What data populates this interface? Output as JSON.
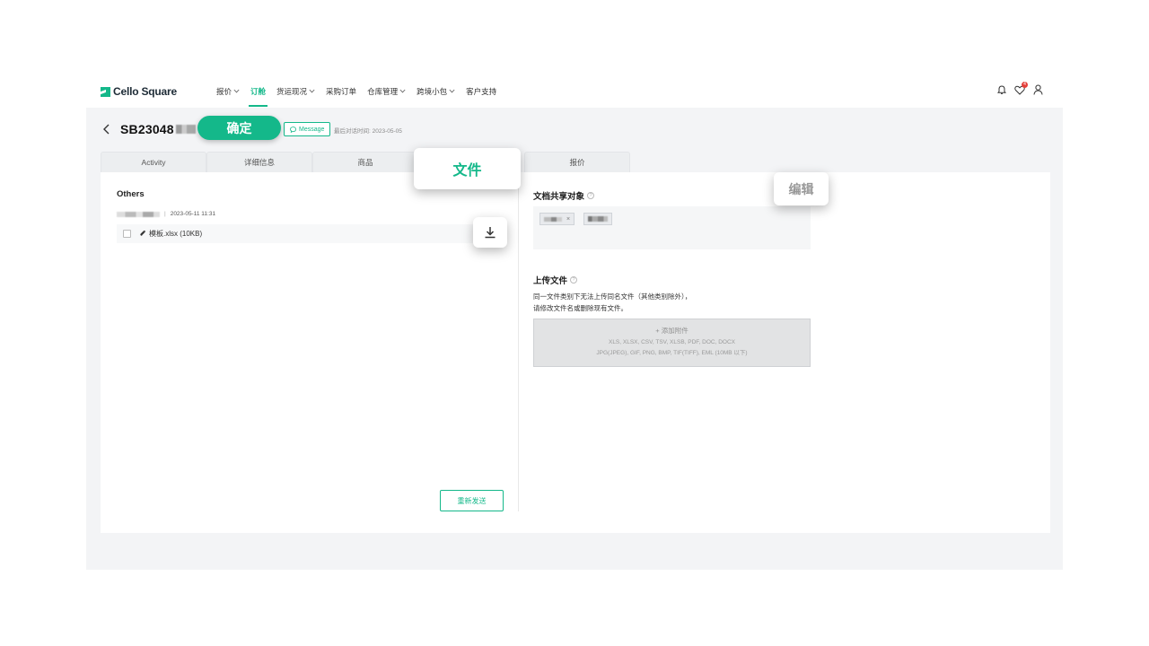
{
  "app": {
    "logo_text": "Cello Square"
  },
  "nav": {
    "items": [
      {
        "label": "报价",
        "dropdown": true
      },
      {
        "label": "订舱",
        "dropdown": false,
        "active": true
      },
      {
        "label": "货运现况",
        "dropdown": true
      },
      {
        "label": "采购订单",
        "dropdown": false
      },
      {
        "label": "仓库管理",
        "dropdown": true
      },
      {
        "label": "跨境小包",
        "dropdown": true
      },
      {
        "label": "客户支持",
        "dropdown": false
      }
    ],
    "notification_badge": "4"
  },
  "header": {
    "order_id": "SB23048",
    "message_label": "Message",
    "last_chat": "最后对话时间: 2023-05-05"
  },
  "tabs": [
    "Activity",
    "详细信息",
    "商品",
    "报价"
  ],
  "left": {
    "section_title": "Others",
    "sender_time": "2023-05-11 11:31",
    "separator": "|",
    "file_name": "模板.xlsx (10KB)",
    "resend_label": "重新发送"
  },
  "right": {
    "share_title": "文档共享对象",
    "chip_remove": "×",
    "upload_title": "上传文件",
    "upload_desc_1": "同一文件类别下无法上传同名文件（其他类别除外），",
    "upload_desc_2": "请修改文件名或删除现有文件。",
    "upload_add": "+ 添加附件",
    "upload_types_1": "XLS, XLSX, CSV, TSV, XLSB, PDF, DOC, DOCX",
    "upload_types_2": "JPG(JPEG), GIF, PNG, BMP, TIF(TIFF), EML (10MB 以下)"
  },
  "overlays": {
    "confirm_label": "确定",
    "files_label": "文件",
    "edit_label": "编辑"
  },
  "colors": {
    "accent": "#14b88a",
    "badge": "#e4403b"
  }
}
